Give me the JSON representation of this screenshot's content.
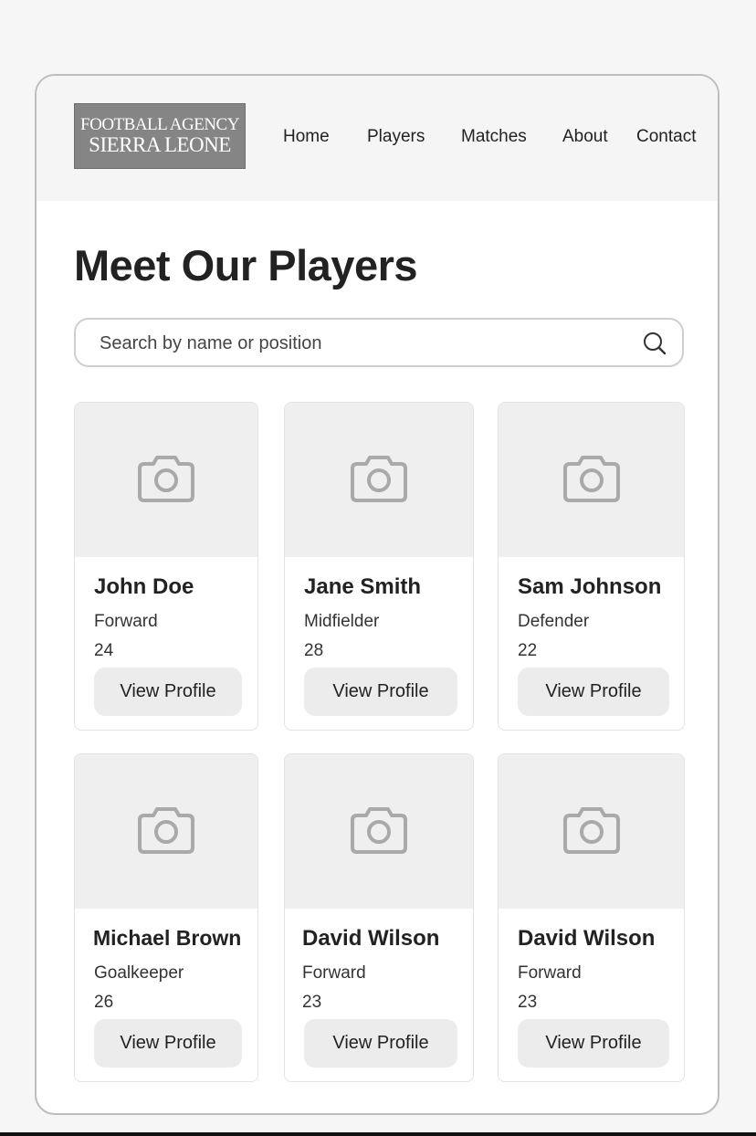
{
  "brand": {
    "line1": "FOOTBALL AGENCY",
    "line2": "SIERRA LEONE"
  },
  "nav": {
    "home": "Home",
    "players": "Players",
    "matches": "Matches",
    "about": "About",
    "contact": "Contact"
  },
  "page": {
    "title": "Meet Our Players"
  },
  "search": {
    "placeholder": "Search by name or position",
    "value": ""
  },
  "players": [
    {
      "name": "John Doe",
      "position": "Forward",
      "age": "24",
      "button": "View Profile"
    },
    {
      "name": "Jane Smith",
      "position": "Midfielder",
      "age": "28",
      "button": "View Profile"
    },
    {
      "name": "Sam Johnson",
      "position": "Defender",
      "age": "22",
      "button": "View Profile"
    },
    {
      "name": "Michael Brown",
      "position": "Goalkeeper",
      "age": "26",
      "button": "View Profile"
    },
    {
      "name": "David Wilson",
      "position": "Forward",
      "age": "23",
      "button": "View Profile"
    },
    {
      "name": "David Wilson",
      "position": "Forward",
      "age": "23",
      "button": "View Profile"
    }
  ],
  "icons": {
    "search": "search-icon",
    "photo_placeholder": "camera-icon"
  },
  "colors": {
    "page_bg": "#f6f6f6",
    "header_bg": "#f5f5f5",
    "logo_bg": "#858585",
    "photo_bg": "#efefef",
    "button_bg": "#ececec",
    "text": "#222222"
  }
}
